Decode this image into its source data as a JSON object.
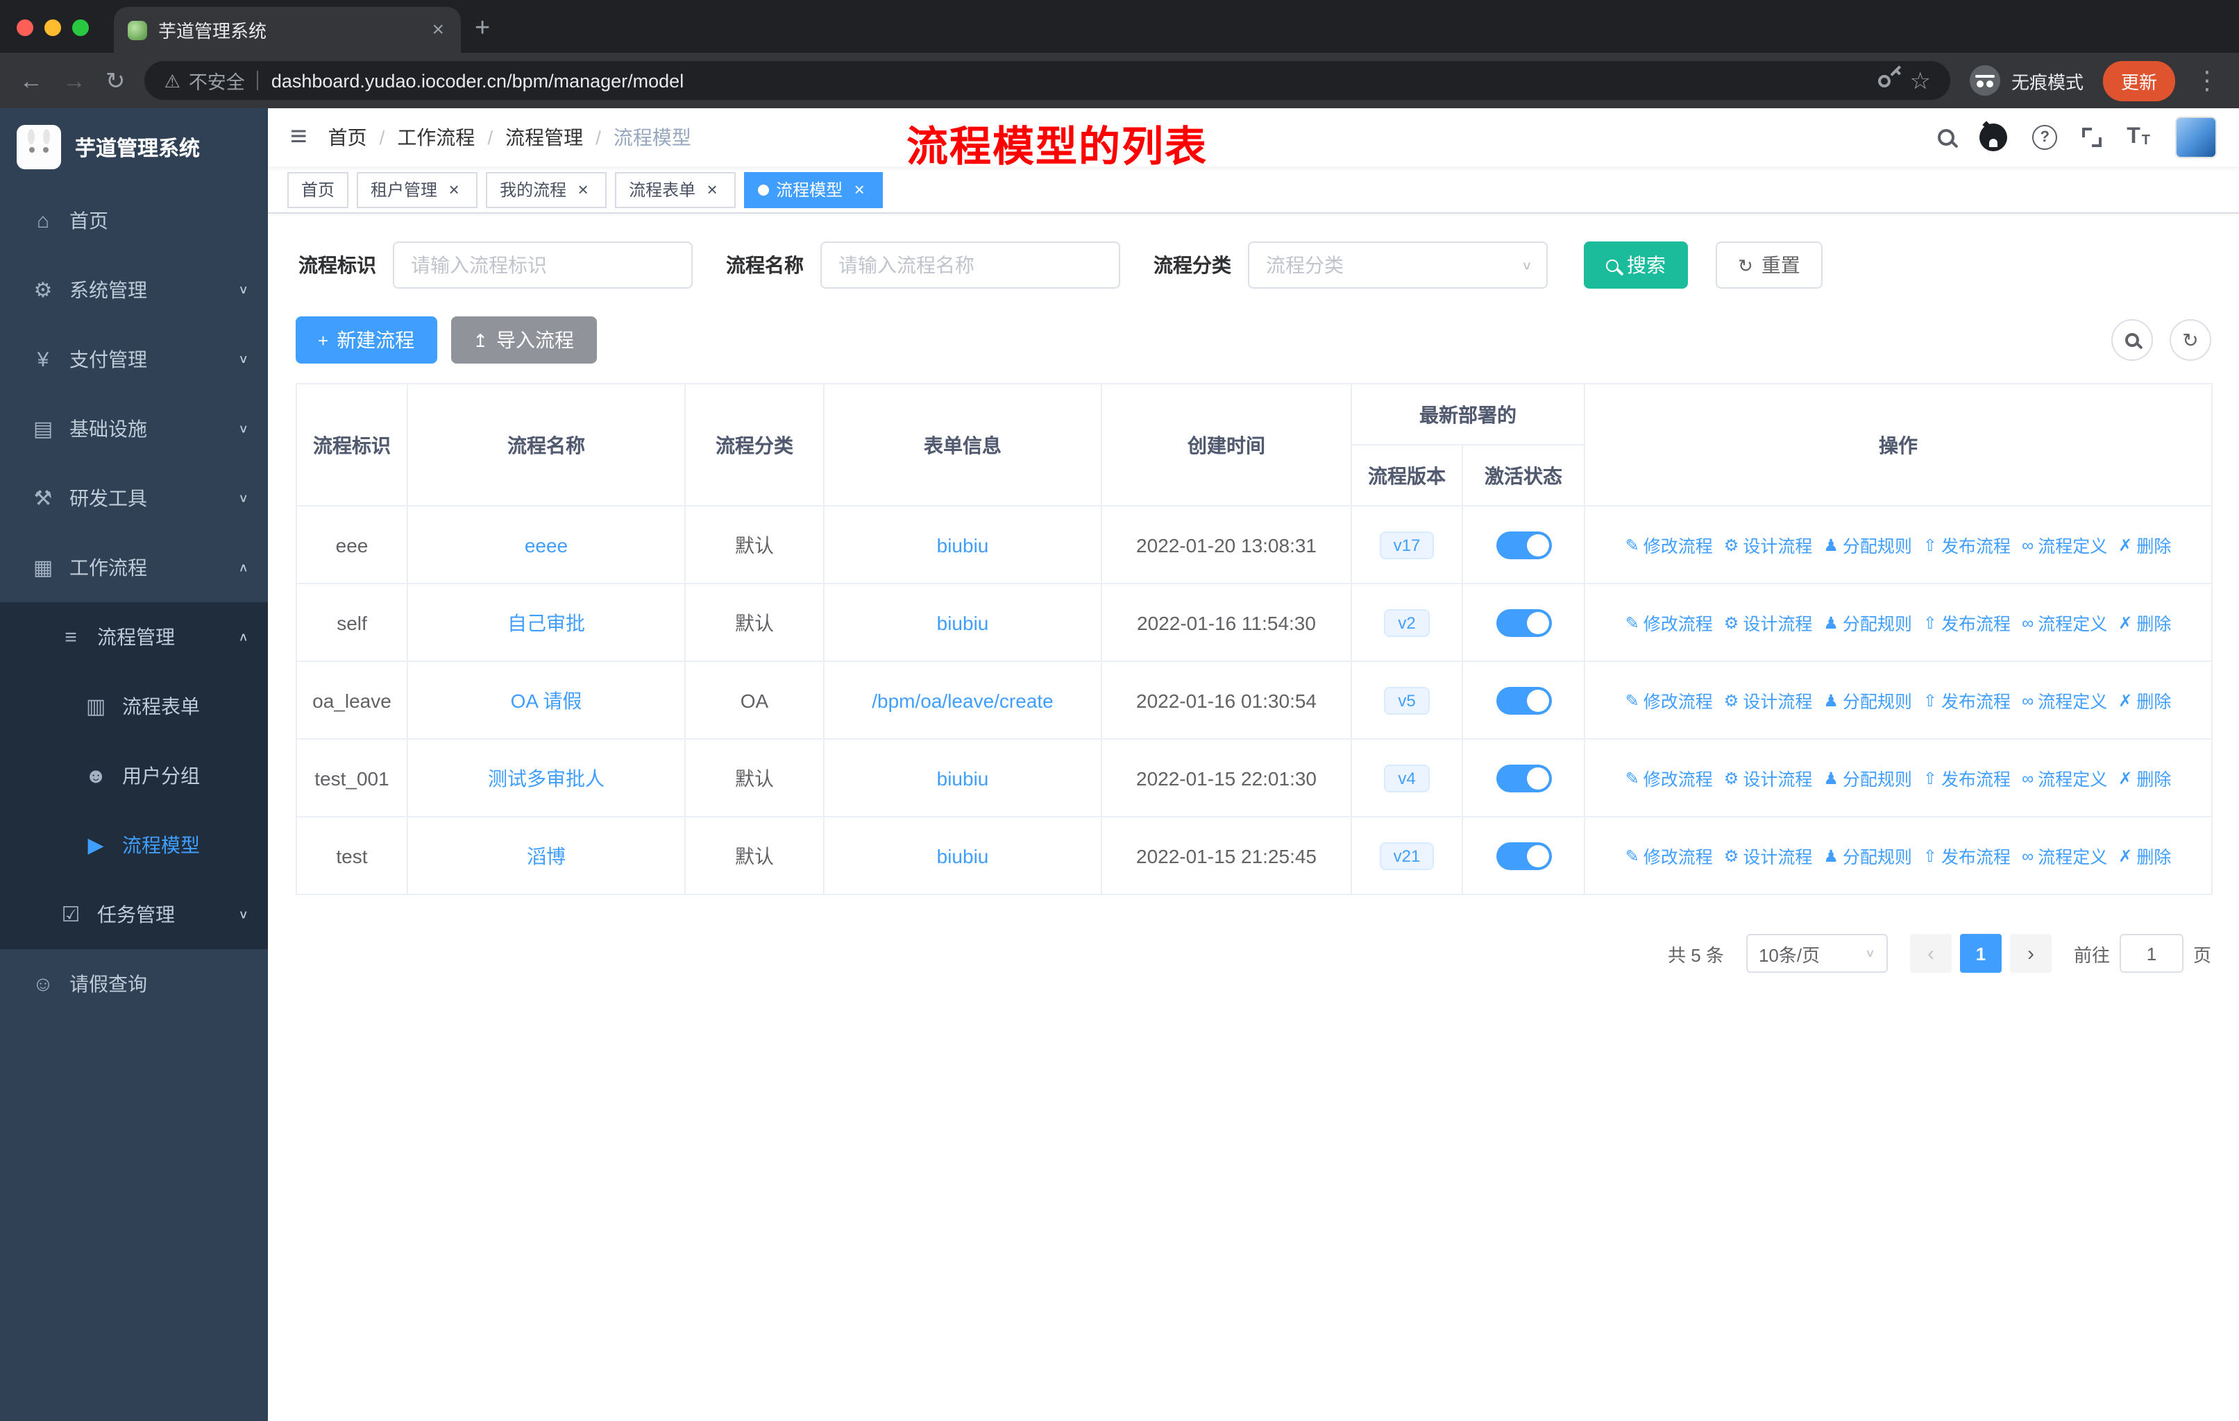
{
  "colors": {
    "accent": "#409eff",
    "search_button": "#1abc9c",
    "annotation": "#ff0000",
    "sidebar_bg": "#304156",
    "sidebar_sub_bg": "#1f2d3d",
    "update_button": "#e0532f"
  },
  "icons": {
    "back": "←",
    "forward": "→",
    "reload": "↻",
    "menu": "⋮",
    "star": "☆",
    "warning": "⚠",
    "plus_tab": "+",
    "close_tab": "×",
    "help": "?",
    "refresh": "↻",
    "caret_down": "∨",
    "prev": "‹",
    "next": "›",
    "new": "+",
    "import": "↥",
    "hamburger": "≡",
    "font": "T"
  },
  "browser": {
    "tab_title": "芋道管理系统",
    "security_label": "不安全",
    "url": "dashboard.yudao.iocoder.cn/bpm/manager/model",
    "incognito_label": "无痕模式",
    "update_label": "更新"
  },
  "sidebar": {
    "logo_title": "芋道管理系统",
    "items": [
      {
        "id": "home",
        "label": "首页",
        "icon": "⌂",
        "icon_name": "home-icon",
        "level": 0
      },
      {
        "id": "system",
        "label": "系统管理",
        "icon": "⚙",
        "icon_name": "gear-icon",
        "level": 0,
        "arrow": "down"
      },
      {
        "id": "payment",
        "label": "支付管理",
        "icon": "¥",
        "icon_name": "yen-icon",
        "level": 0,
        "arrow": "down"
      },
      {
        "id": "infrastructure",
        "label": "基础设施",
        "icon": "▤",
        "icon_name": "infrastructure-icon",
        "level": 0,
        "arrow": "down"
      },
      {
        "id": "devtools",
        "label": "研发工具",
        "icon": "⚒",
        "icon_name": "tools-icon",
        "level": 0,
        "arrow": "down"
      },
      {
        "id": "workflow",
        "label": "工作流程",
        "icon": "▦",
        "icon_name": "workflow-icon",
        "level": 0,
        "arrow": "up"
      },
      {
        "id": "process-management",
        "label": "流程管理",
        "icon": "≡",
        "icon_name": "list-icon",
        "level": 1,
        "arrow": "up"
      },
      {
        "id": "process-form",
        "label": "流程表单",
        "icon": "▥",
        "icon_name": "document-icon",
        "level": 2
      },
      {
        "id": "user-group",
        "label": "用户分组",
        "icon": "☻",
        "icon_name": "user-group-icon",
        "level": 2
      },
      {
        "id": "process-model",
        "label": "流程模型",
        "icon": "▶",
        "icon_name": "paper-plane-icon",
        "level": 2,
        "active": true
      },
      {
        "id": "task-management",
        "label": "任务管理",
        "icon": "☑",
        "icon_name": "task-icon",
        "level": 1,
        "arrow": "down"
      },
      {
        "id": "leave-query",
        "label": "请假查询",
        "icon": "☺",
        "icon_name": "person-icon",
        "level": 0
      }
    ]
  },
  "header": {
    "breadcrumb": [
      "首页",
      "工作流程",
      "流程管理",
      "流程模型"
    ],
    "annotation": "流程模型的列表"
  },
  "tags": [
    {
      "label": "首页",
      "closable": false,
      "active": false
    },
    {
      "label": "租户管理",
      "closable": true,
      "active": false
    },
    {
      "label": "我的流程",
      "closable": true,
      "active": false
    },
    {
      "label": "流程表单",
      "closable": true,
      "active": false
    },
    {
      "label": "流程模型",
      "closable": true,
      "active": true
    }
  ],
  "filters": {
    "id_label": "流程标识",
    "id_placeholder": "请输入流程标识",
    "name_label": "流程名称",
    "name_placeholder": "请输入流程名称",
    "category_label": "流程分类",
    "category_placeholder": "流程分类",
    "search_label": "搜索",
    "reset_label": "重置"
  },
  "toolbar": {
    "create_label": "新建流程",
    "import_label": "导入流程"
  },
  "table": {
    "headers": {
      "id": "流程标识",
      "name": "流程名称",
      "category": "流程分类",
      "form": "表单信息",
      "created": "创建时间",
      "deploy_group": "最新部署的",
      "version": "流程版本",
      "status": "激活状态",
      "actions": "操作"
    },
    "actions": [
      {
        "name": "edit-process-link",
        "icon": "✎",
        "label": "修改流程"
      },
      {
        "name": "design-process-link",
        "icon": "⚙",
        "label": "设计流程"
      },
      {
        "name": "assign-rule-link",
        "icon": "♟",
        "label": "分配规则"
      },
      {
        "name": "publish-process-link",
        "icon": "⇧",
        "label": "发布流程"
      },
      {
        "name": "process-definition-link",
        "icon": "∞",
        "label": "流程定义"
      },
      {
        "name": "delete-link",
        "icon": "✗",
        "label": "删除"
      }
    ],
    "rows": [
      {
        "id": "eee",
        "name": "eeee",
        "category": "默认",
        "form": "biubiu",
        "created": "2022-01-20 13:08:31",
        "version": "v17",
        "status_on": true
      },
      {
        "id": "self",
        "name": "自己审批",
        "category": "默认",
        "form": "biubiu",
        "created": "2022-01-16 11:54:30",
        "version": "v2",
        "status_on": true
      },
      {
        "id": "oa_leave",
        "name": "OA 请假",
        "category": "OA",
        "form": "/bpm/oa/leave/create",
        "created": "2022-01-16 01:30:54",
        "version": "v5",
        "status_on": true
      },
      {
        "id": "test_001",
        "name": "测试多审批人",
        "category": "默认",
        "form": "biubiu",
        "created": "2022-01-15 22:01:30",
        "version": "v4",
        "status_on": true
      },
      {
        "id": "test",
        "name": "滔博",
        "category": "默认",
        "form": "biubiu",
        "created": "2022-01-15 21:25:45",
        "version": "v21",
        "status_on": true
      }
    ]
  },
  "pagination": {
    "total": "共 5 条",
    "page_size": "10条/页",
    "current": "1",
    "goto_label": "前往",
    "goto_value": "1",
    "page_suffix": "页"
  }
}
